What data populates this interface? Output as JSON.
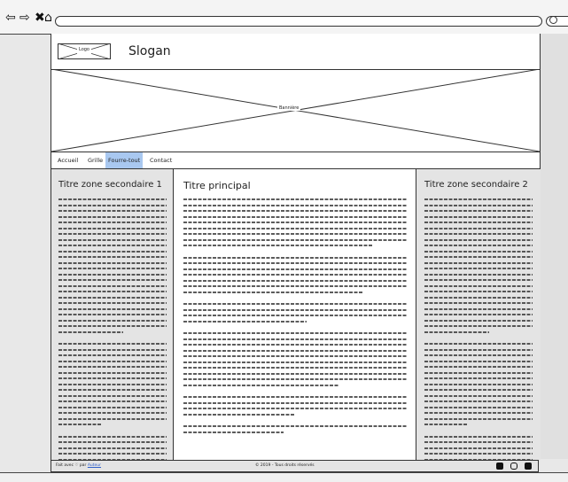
{
  "browser": {
    "back_icon": "arrow-left-icon",
    "forward_icon": "arrow-right-icon",
    "close_icon": "x-icon",
    "home_icon": "home-icon",
    "search_icon": "search-icon"
  },
  "header": {
    "logo_label": "Logo",
    "slogan": "Slogan"
  },
  "banner": {
    "label": "Bannière"
  },
  "nav": {
    "items": [
      "Accueil",
      "Grille",
      "Fourre-tout",
      "Contact"
    ],
    "active_index": 2
  },
  "sidebar_left": {
    "title": "Titre zone secondaire 1"
  },
  "main": {
    "title": "Titre principal"
  },
  "sidebar_right": {
    "title": "Titre zone secondaire 2"
  },
  "footer": {
    "made_with": "Fait avec ♡ par",
    "author_link": "Auteur",
    "copyright": "© 2019 - Tous droits réservés",
    "social_icons": [
      "facebook-icon",
      "instagram-icon",
      "twitter-icon"
    ]
  },
  "colors": {
    "active_nav": "#a9c8f0",
    "sidebar_bg": "#e4e4e4",
    "link": "#2f5fc9"
  }
}
